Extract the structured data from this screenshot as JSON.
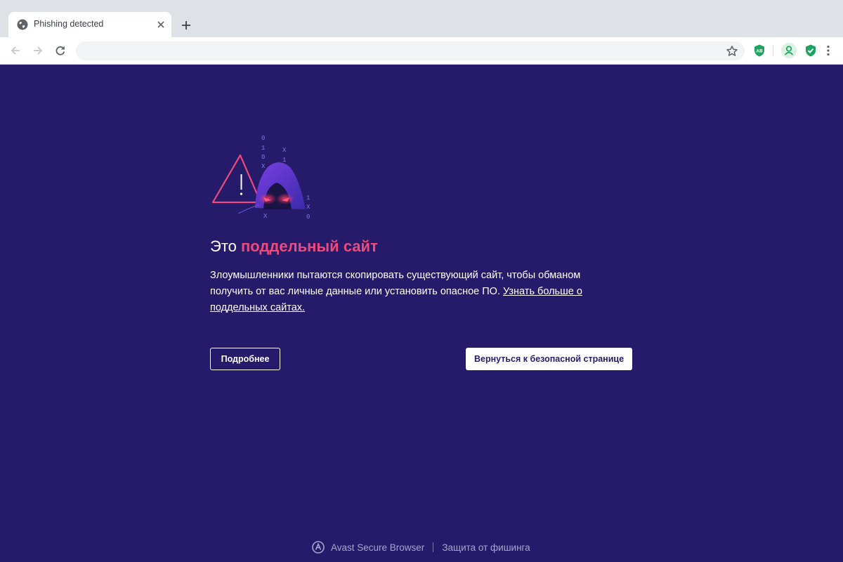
{
  "browser": {
    "tab": {
      "title": "Phishing detected",
      "favicon": "globe-icon"
    },
    "toolbar": {
      "address_value": "",
      "back_icon": "arrow-left-icon",
      "forward_icon": "arrow-right-icon",
      "reload_icon": "reload-icon",
      "bookmark_icon": "star-icon",
      "extensions": [
        {
          "name": "adblock-icon",
          "label": "AB",
          "color": "#1ea362"
        },
        {
          "name": "avast-shield-icon",
          "color": "#1ea362"
        }
      ]
    }
  },
  "warning": {
    "heading_prefix": "Это ",
    "heading_accent": "поддельный сайт",
    "body": "Злоумышленники пытаются скопировать существующий сайт, чтобы обманом получить от вас личные данные или установить опасное ПО. ",
    "learn_more": "Узнать больше о поддельных сайтах.",
    "details_button": "Подробнее",
    "back_button": "Вернуться к безопасной странице",
    "illustration": "hacker-warning-illustration",
    "accent_color": "#ef4a7b",
    "background_color": "#261b6b"
  },
  "footer": {
    "brand": "Avast Secure Browser",
    "feature": "Защита от фишинга",
    "logo": "avast-logo-icon"
  }
}
